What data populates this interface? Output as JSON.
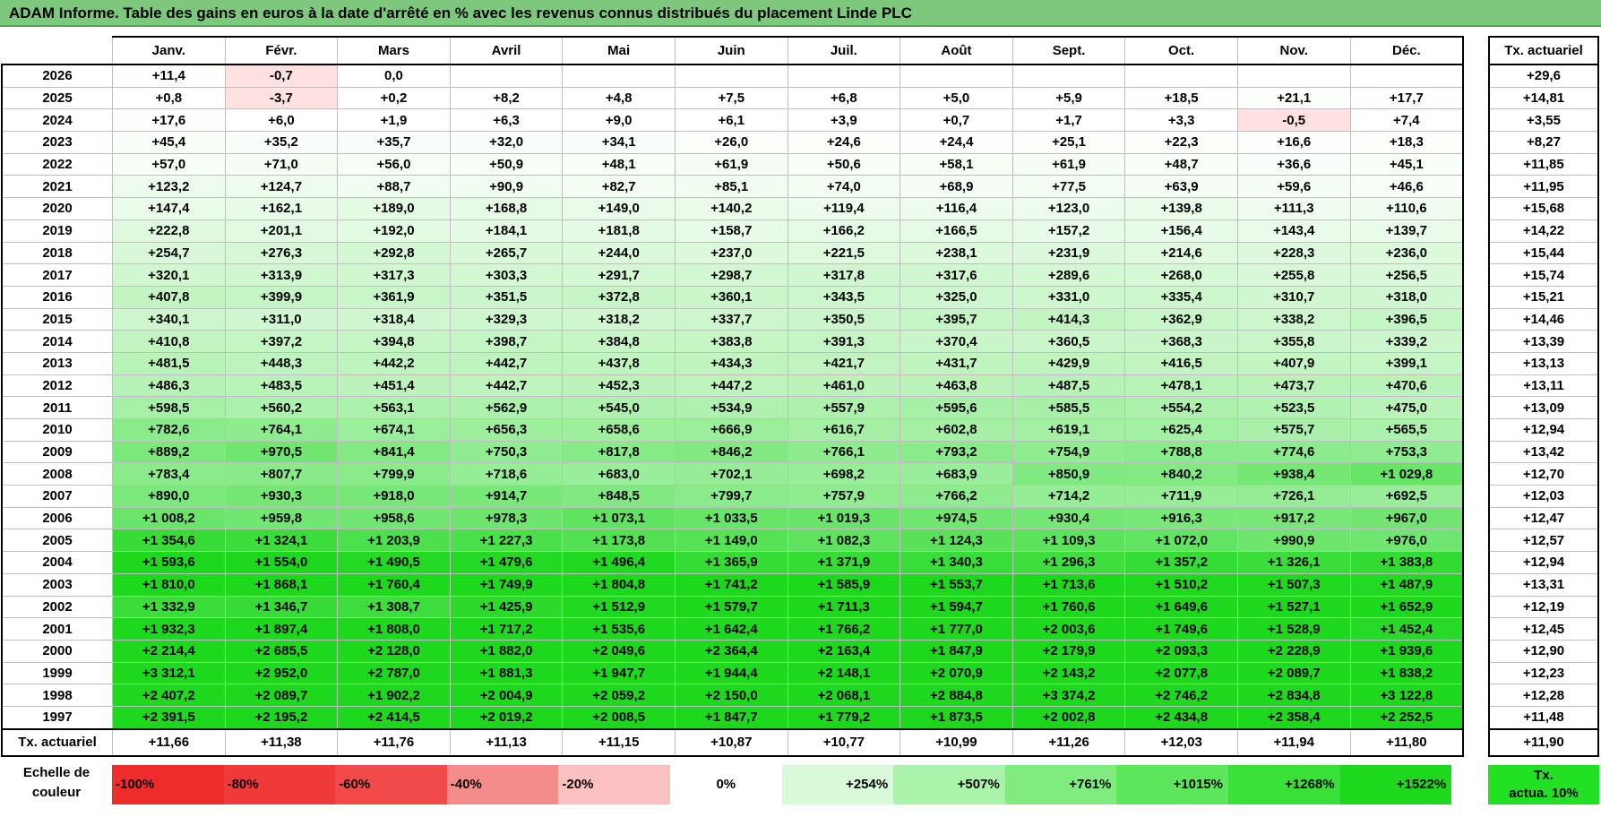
{
  "title": "ADAM Informe. Table des gains en euros à la date d'arrêté en % avec les revenus connus distribués du placement Linde PLC",
  "months": [
    "Janv.",
    "Févr.",
    "Mars",
    "Avril",
    "Mai",
    "Juin",
    "Juil.",
    "Août",
    "Sept.",
    "Oct.",
    "Nov.",
    "Déc."
  ],
  "side_header": "Tx. actuariel",
  "footer_label": "Tx. actuariel",
  "rows": [
    {
      "year": "2026",
      "values": [
        "+11,4",
        "-0,7",
        "0,0",
        "",
        "",
        "",
        "",
        "",
        "",
        "",
        "",
        ""
      ],
      "tx": "+29,6"
    },
    {
      "year": "2025",
      "values": [
        "+0,8",
        "-3,7",
        "+0,2",
        "+8,2",
        "+4,8",
        "+7,5",
        "+6,8",
        "+5,0",
        "+5,9",
        "+18,5",
        "+21,1",
        "+17,7"
      ],
      "tx": "+14,81"
    },
    {
      "year": "2024",
      "values": [
        "+17,6",
        "+6,0",
        "+1,9",
        "+6,3",
        "+9,0",
        "+6,1",
        "+3,9",
        "+0,7",
        "+1,7",
        "+3,3",
        "-0,5",
        "+7,4"
      ],
      "tx": "+3,55"
    },
    {
      "year": "2023",
      "values": [
        "+45,4",
        "+35,2",
        "+35,7",
        "+32,0",
        "+34,1",
        "+26,0",
        "+24,6",
        "+24,4",
        "+25,1",
        "+22,3",
        "+16,6",
        "+18,3"
      ],
      "tx": "+8,27"
    },
    {
      "year": "2022",
      "values": [
        "+57,0",
        "+71,0",
        "+56,0",
        "+50,9",
        "+48,1",
        "+61,9",
        "+50,6",
        "+58,1",
        "+61,9",
        "+48,7",
        "+36,6",
        "+45,1"
      ],
      "tx": "+11,85"
    },
    {
      "year": "2021",
      "values": [
        "+123,2",
        "+124,7",
        "+88,7",
        "+90,9",
        "+82,7",
        "+85,1",
        "+74,0",
        "+68,9",
        "+77,5",
        "+63,9",
        "+59,6",
        "+46,6"
      ],
      "tx": "+11,95"
    },
    {
      "year": "2020",
      "values": [
        "+147,4",
        "+162,1",
        "+189,0",
        "+168,8",
        "+149,0",
        "+140,2",
        "+119,4",
        "+116,4",
        "+123,0",
        "+139,8",
        "+111,3",
        "+110,6"
      ],
      "tx": "+15,68"
    },
    {
      "year": "2019",
      "values": [
        "+222,8",
        "+201,1",
        "+192,0",
        "+184,1",
        "+181,8",
        "+158,7",
        "+166,2",
        "+166,5",
        "+157,2",
        "+156,4",
        "+143,4",
        "+139,7"
      ],
      "tx": "+14,22"
    },
    {
      "year": "2018",
      "values": [
        "+254,7",
        "+276,3",
        "+292,8",
        "+265,7",
        "+244,0",
        "+237,0",
        "+221,5",
        "+238,1",
        "+231,9",
        "+214,6",
        "+228,3",
        "+236,0"
      ],
      "tx": "+15,44"
    },
    {
      "year": "2017",
      "values": [
        "+320,1",
        "+313,9",
        "+317,3",
        "+303,3",
        "+291,7",
        "+298,7",
        "+317,8",
        "+317,6",
        "+289,6",
        "+268,0",
        "+255,8",
        "+256,5"
      ],
      "tx": "+15,74"
    },
    {
      "year": "2016",
      "values": [
        "+407,8",
        "+399,9",
        "+361,9",
        "+351,5",
        "+372,8",
        "+360,1",
        "+343,5",
        "+325,0",
        "+331,0",
        "+335,4",
        "+310,7",
        "+318,0"
      ],
      "tx": "+15,21"
    },
    {
      "year": "2015",
      "values": [
        "+340,1",
        "+311,0",
        "+318,4",
        "+329,3",
        "+318,2",
        "+337,7",
        "+350,5",
        "+395,7",
        "+414,3",
        "+362,9",
        "+338,2",
        "+396,5"
      ],
      "tx": "+14,46"
    },
    {
      "year": "2014",
      "values": [
        "+410,8",
        "+397,2",
        "+394,8",
        "+398,7",
        "+384,8",
        "+383,8",
        "+391,3",
        "+370,4",
        "+360,5",
        "+368,3",
        "+355,8",
        "+339,2"
      ],
      "tx": "+13,39"
    },
    {
      "year": "2013",
      "values": [
        "+481,5",
        "+448,3",
        "+442,2",
        "+442,7",
        "+437,8",
        "+434,3",
        "+421,7",
        "+431,7",
        "+429,9",
        "+416,5",
        "+407,9",
        "+399,1"
      ],
      "tx": "+13,13"
    },
    {
      "year": "2012",
      "values": [
        "+486,3",
        "+483,5",
        "+451,4",
        "+442,7",
        "+452,3",
        "+447,2",
        "+461,0",
        "+463,8",
        "+487,5",
        "+478,1",
        "+473,7",
        "+470,6"
      ],
      "tx": "+13,11"
    },
    {
      "year": "2011",
      "values": [
        "+598,5",
        "+560,2",
        "+563,1",
        "+562,9",
        "+545,0",
        "+534,9",
        "+557,9",
        "+595,6",
        "+585,5",
        "+554,2",
        "+523,5",
        "+475,0"
      ],
      "tx": "+13,09"
    },
    {
      "year": "2010",
      "values": [
        "+782,6",
        "+764,1",
        "+674,1",
        "+656,3",
        "+658,6",
        "+666,9",
        "+616,7",
        "+602,8",
        "+619,1",
        "+625,4",
        "+575,7",
        "+565,5"
      ],
      "tx": "+12,94"
    },
    {
      "year": "2009",
      "values": [
        "+889,2",
        "+970,5",
        "+841,4",
        "+750,3",
        "+817,8",
        "+846,2",
        "+766,1",
        "+793,2",
        "+754,9",
        "+788,8",
        "+774,6",
        "+753,3"
      ],
      "tx": "+13,42"
    },
    {
      "year": "2008",
      "values": [
        "+783,4",
        "+807,7",
        "+799,9",
        "+718,6",
        "+683,0",
        "+702,1",
        "+698,2",
        "+683,9",
        "+850,9",
        "+840,2",
        "+938,4",
        "+1 029,8"
      ],
      "tx": "+12,70"
    },
    {
      "year": "2007",
      "values": [
        "+890,0",
        "+930,3",
        "+918,0",
        "+914,7",
        "+848,5",
        "+799,7",
        "+757,9",
        "+766,2",
        "+714,2",
        "+711,9",
        "+726,1",
        "+692,5"
      ],
      "tx": "+12,03"
    },
    {
      "year": "2006",
      "values": [
        "+1 008,2",
        "+959,8",
        "+958,6",
        "+978,3",
        "+1 073,1",
        "+1 033,5",
        "+1 019,3",
        "+974,5",
        "+930,4",
        "+916,3",
        "+917,2",
        "+967,0"
      ],
      "tx": "+12,47"
    },
    {
      "year": "2005",
      "values": [
        "+1 354,6",
        "+1 324,1",
        "+1 203,9",
        "+1 227,3",
        "+1 173,8",
        "+1 149,0",
        "+1 082,3",
        "+1 124,3",
        "+1 109,3",
        "+1 072,0",
        "+990,9",
        "+976,0"
      ],
      "tx": "+12,57"
    },
    {
      "year": "2004",
      "values": [
        "+1 593,6",
        "+1 554,0",
        "+1 490,5",
        "+1 479,6",
        "+1 496,4",
        "+1 365,9",
        "+1 371,9",
        "+1 340,3",
        "+1 296,3",
        "+1 357,2",
        "+1 326,1",
        "+1 383,8"
      ],
      "tx": "+12,94"
    },
    {
      "year": "2003",
      "values": [
        "+1 810,0",
        "+1 868,1",
        "+1 760,4",
        "+1 749,9",
        "+1 804,8",
        "+1 741,2",
        "+1 585,9",
        "+1 553,7",
        "+1 713,6",
        "+1 510,2",
        "+1 507,3",
        "+1 487,9"
      ],
      "tx": "+13,31"
    },
    {
      "year": "2002",
      "values": [
        "+1 332,9",
        "+1 346,7",
        "+1 308,7",
        "+1 425,9",
        "+1 512,9",
        "+1 579,7",
        "+1 711,3",
        "+1 594,7",
        "+1 760,6",
        "+1 649,6",
        "+1 527,1",
        "+1 652,9"
      ],
      "tx": "+12,19"
    },
    {
      "year": "2001",
      "values": [
        "+1 932,3",
        "+1 897,4",
        "+1 808,0",
        "+1 717,2",
        "+1 535,6",
        "+1 642,4",
        "+1 766,2",
        "+1 777,0",
        "+2 003,6",
        "+1 749,6",
        "+1 528,9",
        "+1 452,4"
      ],
      "tx": "+12,45"
    },
    {
      "year": "2000",
      "values": [
        "+2 214,4",
        "+2 685,5",
        "+2 128,0",
        "+1 882,0",
        "+2 049,6",
        "+2 364,4",
        "+2 163,4",
        "+1 847,9",
        "+2 179,9",
        "+2 093,3",
        "+2 228,9",
        "+1 939,6"
      ],
      "tx": "+12,90"
    },
    {
      "year": "1999",
      "values": [
        "+3 312,1",
        "+2 952,0",
        "+2 787,0",
        "+1 881,3",
        "+1 947,7",
        "+1 944,4",
        "+2 148,1",
        "+2 070,9",
        "+2 143,2",
        "+2 077,8",
        "+2 089,7",
        "+1 838,2"
      ],
      "tx": "+12,23"
    },
    {
      "year": "1998",
      "values": [
        "+2 407,2",
        "+2 089,7",
        "+1 902,2",
        "+2 004,9",
        "+2 059,2",
        "+2 150,0",
        "+2 068,1",
        "+2 884,8",
        "+3 374,2",
        "+2 746,2",
        "+2 834,8",
        "+3 122,8"
      ],
      "tx": "+12,28"
    },
    {
      "year": "1997",
      "values": [
        "+2 391,5",
        "+2 195,2",
        "+2 414,5",
        "+2 019,2",
        "+2 008,5",
        "+1 847,7",
        "+1 779,2",
        "+1 873,5",
        "+2 002,8",
        "+2 434,8",
        "+2 358,4",
        "+2 252,5"
      ],
      "tx": "+11,48"
    }
  ],
  "footer_values": [
    "+11,66",
    "+11,38",
    "+11,76",
    "+11,13",
    "+11,15",
    "+10,87",
    "+10,77",
    "+10,99",
    "+11,26",
    "+12,03",
    "+11,94",
    "+11,80"
  ],
  "footer_tx": "+11,90",
  "legend": {
    "label_line1": "Echelle de",
    "label_line2": "couleur",
    "cells": [
      {
        "text": "-100%",
        "color": "#ee2c2c"
      },
      {
        "text": "-80%",
        "color": "#f03a3a"
      },
      {
        "text": "-60%",
        "color": "#f24a4a"
      },
      {
        "text": "-40%",
        "color": "#f58c8c"
      },
      {
        "text": "-20%",
        "color": "#fbc0c0"
      },
      {
        "text": "0%",
        "color": "#ffffff"
      },
      {
        "text": "+254%",
        "color": "#d8fad8"
      },
      {
        "text": "+507%",
        "color": "#aaf3aa"
      },
      {
        "text": "+761%",
        "color": "#80ec80"
      },
      {
        "text": "+1015%",
        "color": "#5ce65c"
      },
      {
        "text": "+1268%",
        "color": "#38e038"
      },
      {
        "text": "+1522%",
        "color": "#1ed81e"
      }
    ],
    "tx_line1": "Tx.",
    "tx_line2": "actua. 10%",
    "tx_color": "#22e022"
  },
  "colors": {
    "title_bg": "#7dc87d",
    "negative_cell": "#ffe1e1",
    "max_green": "#1ed81e"
  }
}
